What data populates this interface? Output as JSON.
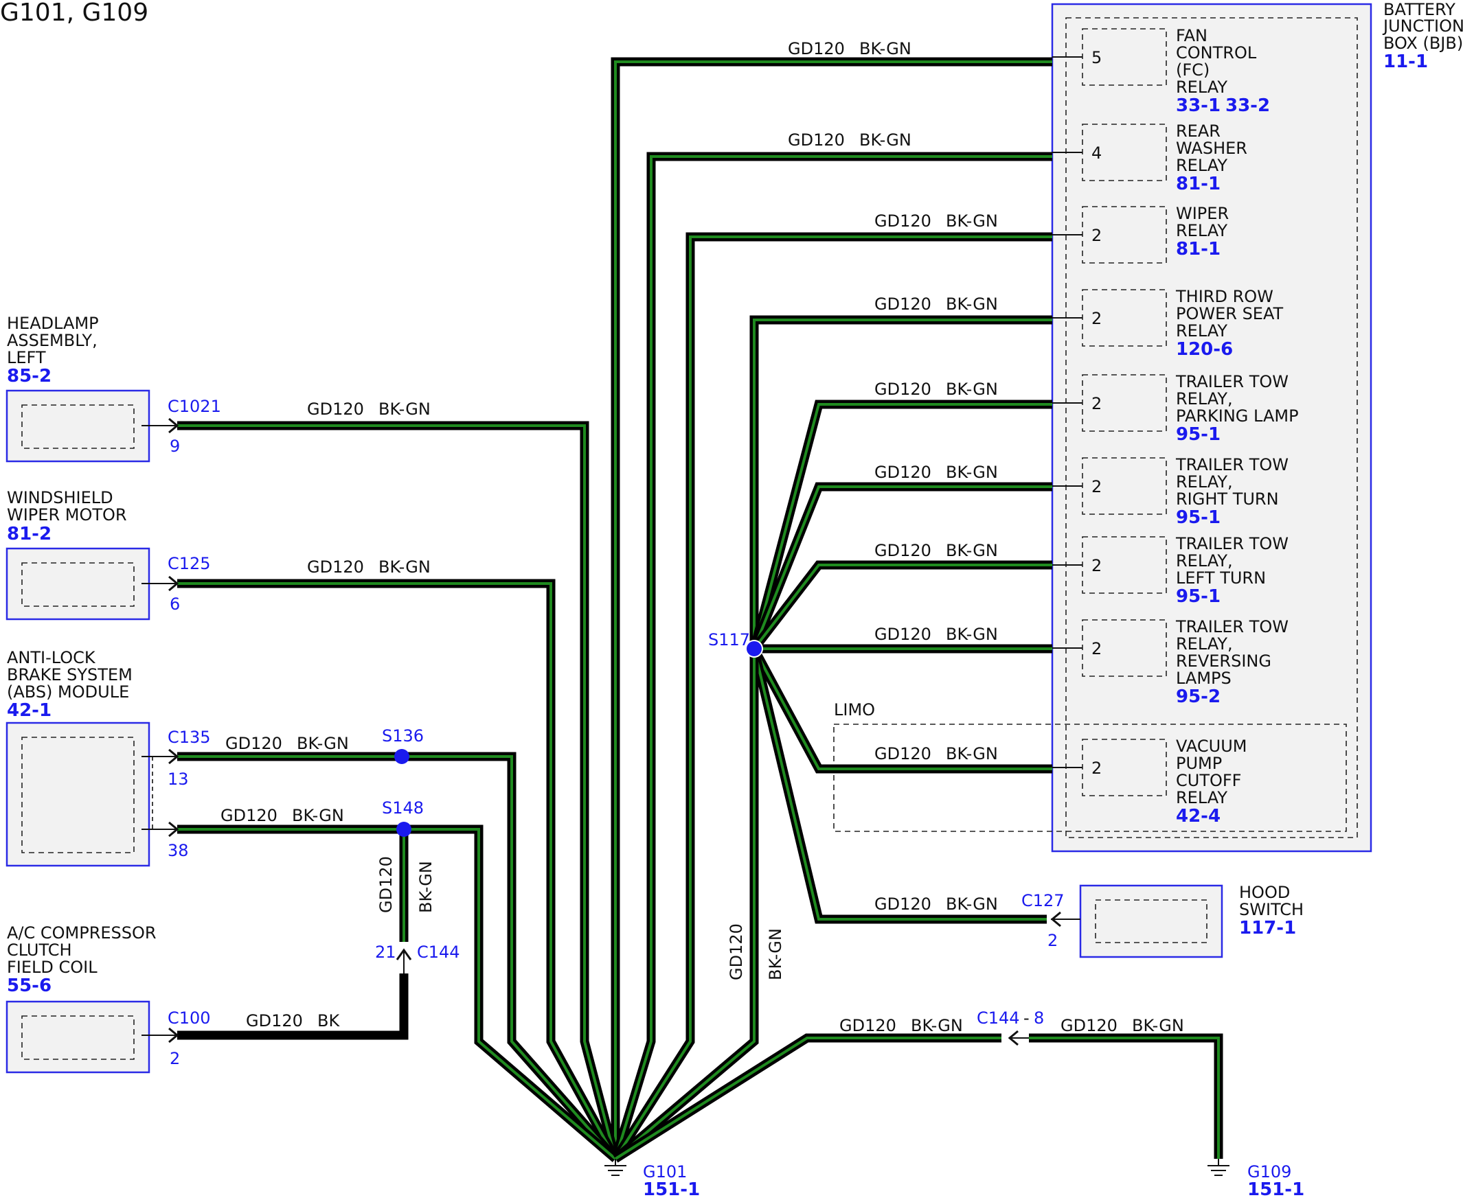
{
  "title": "G101, G109",
  "wire": {
    "circuit": "GD120",
    "color": "BK-GN",
    "color_bk": "BK"
  },
  "palette": {
    "wire_fill": "#1f8a1f",
    "wire_outline": "#000000",
    "blue": "#1a1aee",
    "box_fill": "#f2f2f2"
  },
  "bjb": {
    "name": [
      "BATTERY",
      "JUNCTION",
      "BOX (BJB)"
    ],
    "ref": "11-1",
    "relays": [
      {
        "pin": "5",
        "name": [
          "FAN",
          "CONTROL",
          "(FC)",
          "RELAY"
        ],
        "refs": [
          "33-1",
          "33-2"
        ]
      },
      {
        "pin": "4",
        "name": [
          "REAR",
          "WASHER",
          "RELAY"
        ],
        "refs": [
          "81-1"
        ]
      },
      {
        "pin": "2",
        "name": [
          "WIPER",
          "RELAY"
        ],
        "refs": [
          "81-1"
        ]
      },
      {
        "pin": "2",
        "name": [
          "THIRD ROW",
          "POWER SEAT",
          "RELAY"
        ],
        "refs": [
          "120-6"
        ]
      },
      {
        "pin": "2",
        "name": [
          "TRAILER TOW",
          "RELAY,",
          "PARKING LAMP"
        ],
        "refs": [
          "95-1"
        ]
      },
      {
        "pin": "2",
        "name": [
          "TRAILER TOW",
          "RELAY,",
          "RIGHT TURN"
        ],
        "refs": [
          "95-1"
        ]
      },
      {
        "pin": "2",
        "name": [
          "TRAILER TOW",
          "RELAY,",
          "LEFT TURN"
        ],
        "refs": [
          "95-1"
        ]
      },
      {
        "pin": "2",
        "name": [
          "TRAILER TOW",
          "RELAY,",
          "REVERSING",
          "LAMPS"
        ],
        "refs": [
          "95-2"
        ]
      },
      {
        "pin": "2",
        "name": [
          "VACUUM",
          "PUMP",
          "CUTOFF",
          "RELAY"
        ],
        "refs": [
          "42-4"
        ]
      }
    ]
  },
  "limo_label": "LIMO",
  "left_components": [
    {
      "name": [
        "HEADLAMP",
        "ASSEMBLY,",
        "LEFT"
      ],
      "ref": "85-2",
      "connector": "C1021",
      "pins": [
        "9"
      ]
    },
    {
      "name": [
        "WINDSHIELD",
        "WIPER MOTOR"
      ],
      "ref": "81-2",
      "connector": "C125",
      "pins": [
        "6"
      ]
    },
    {
      "name": [
        "ANTI-LOCK",
        "BRAKE SYSTEM",
        "(ABS) MODULE"
      ],
      "ref": "42-1",
      "connector": "C135",
      "pins": [
        "13",
        "38"
      ]
    },
    {
      "name": [
        "A/C COMPRESSOR",
        "CLUTCH",
        "FIELD COIL"
      ],
      "ref": "55-6",
      "connector": "C100",
      "pins": [
        "2"
      ]
    }
  ],
  "hood_switch": {
    "name": [
      "HOOD",
      "SWITCH"
    ],
    "ref": "117-1",
    "connector": "C127",
    "pin": "2"
  },
  "splices": {
    "s117": "S117",
    "s136": "S136",
    "s148": "S148"
  },
  "inline": {
    "c144": "C144",
    "c144_pin": "21",
    "c144_8": "C144",
    "c144_8_sep": "-",
    "c144_8_pin": "8"
  },
  "grounds": [
    {
      "name": "G101",
      "ref": "151-1"
    },
    {
      "name": "G109",
      "ref": "151-1"
    }
  ]
}
